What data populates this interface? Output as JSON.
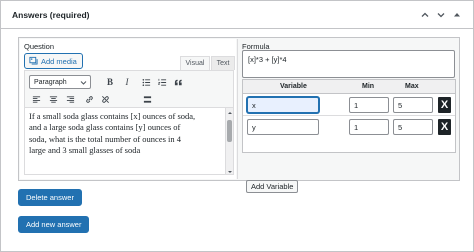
{
  "panel": {
    "title": "Answers (required)",
    "icons": [
      "chevron-up-icon",
      "chevron-down-icon",
      "triangle-collapse-icon"
    ]
  },
  "question": {
    "label": "Question",
    "add_media_label": "Add media",
    "tabs": {
      "visual": "Visual",
      "text": "Text"
    },
    "format_select": "Paragraph",
    "toolbar_icons": [
      "bold",
      "italic",
      "bulleted-list",
      "numbered-list",
      "blockquote",
      "align-left",
      "align-center",
      "align-right",
      "link",
      "unlink",
      "toolbar-toggle"
    ],
    "content_lines": [
      "If a small soda glass contains [x] ounces of soda,",
      "and a large soda glass contains [y] ounces of",
      "soda, what is the total number of ounces in 4",
      "large and 3 small glasses of soda"
    ]
  },
  "formula": {
    "label": "Formula",
    "value": "[x]*3 + [y]*4",
    "columns": {
      "variable": "Variable",
      "min": "Min",
      "max": "Max"
    },
    "variables": [
      {
        "name": "x",
        "min": "1",
        "max": "5",
        "delete": "X"
      },
      {
        "name": "y",
        "min": "1",
        "max": "5",
        "delete": "X"
      }
    ],
    "add_variable_label": "Add Variable"
  },
  "actions": {
    "delete_answer": "Delete answer",
    "add_new_answer": "Add new answer"
  },
  "colors": {
    "primary": "#2271b1",
    "border": "#c3c4c7",
    "text": "#1d2327"
  }
}
